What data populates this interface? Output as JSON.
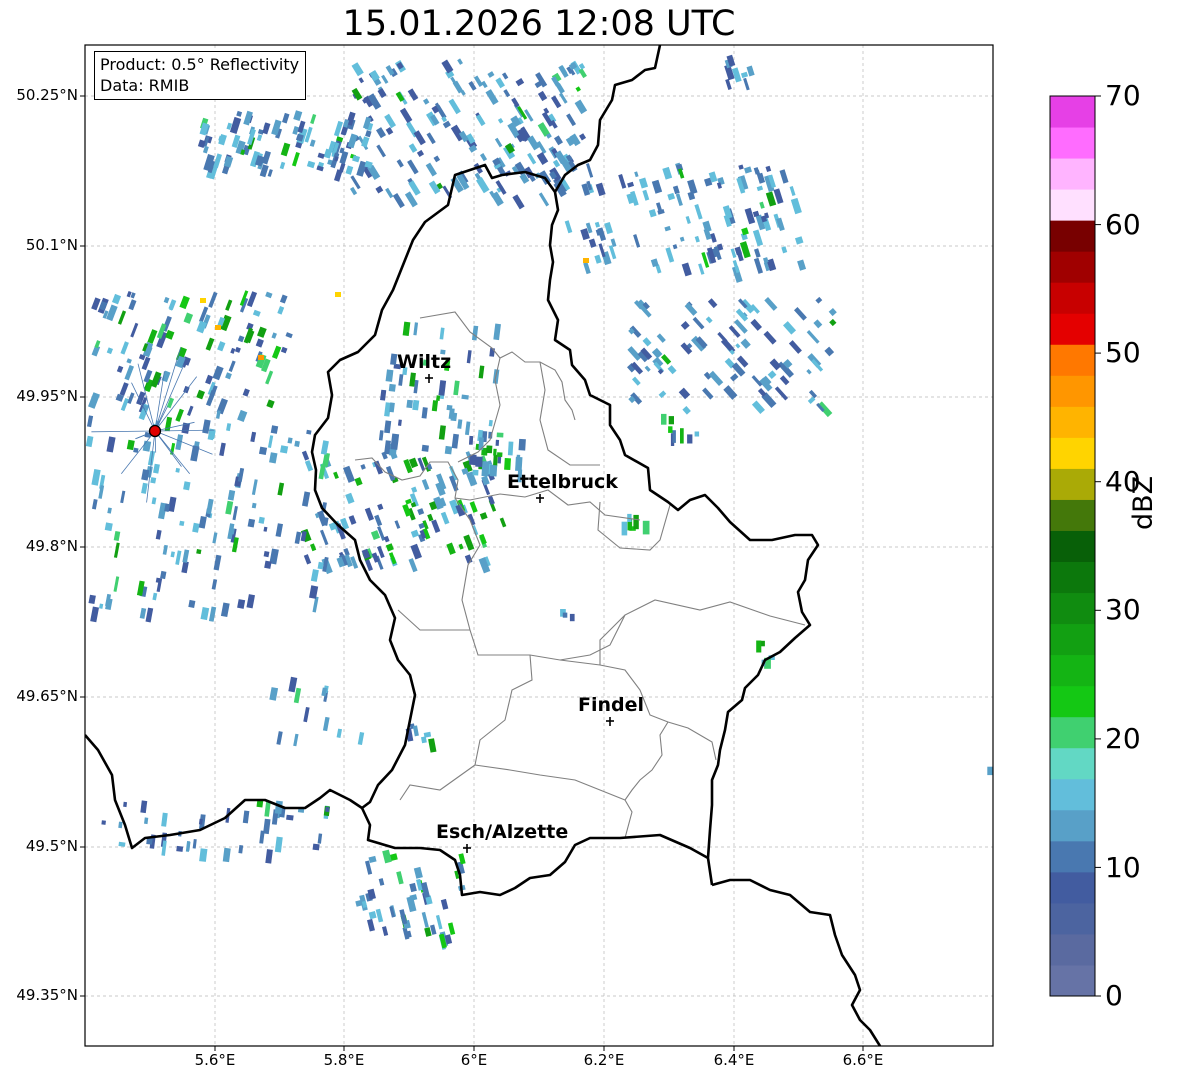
{
  "title": "15.01.2026 12:08 UTC",
  "info_box": {
    "product": "Product: 0.5° Reflectivity",
    "data_source": "Data: RMIB"
  },
  "map": {
    "lon_range": [
      5.4,
      6.8
    ],
    "lat_range": [
      49.3,
      50.3
    ],
    "latitude_ticks": [
      "50.25°N",
      "50.1°N",
      "49.95°N",
      "49.8°N",
      "49.65°N",
      "49.5°N",
      "49.35°N"
    ],
    "longitude_ticks": [
      "5.6°E",
      "5.8°E",
      "6°E",
      "6.2°E",
      "6.4°E",
      "6.6°E"
    ],
    "grid": true,
    "radar_site_color": "#e00000",
    "cities": [
      {
        "name": "Wiltz"
      },
      {
        "name": "Ettelbruck"
      },
      {
        "name": "Findel"
      },
      {
        "name": "Esch/Alzette"
      }
    ]
  },
  "colorbar": {
    "label": "dBZ",
    "ticks": [
      "70",
      "60",
      "50",
      "40",
      "30",
      "20",
      "10",
      "0"
    ],
    "range": [
      0,
      70
    ],
    "step_dbz": 2.5,
    "colors": [
      "#6673a6",
      "#5a6aa0",
      "#4c64a0",
      "#425ca0",
      "#4978b0",
      "#58a0c8",
      "#62bedb",
      "#62d8c4",
      "#40d070",
      "#14c814",
      "#14b414",
      "#12a012",
      "#108c10",
      "#0c780c",
      "#086008",
      "#44780a",
      "#aaaa06",
      "#ffd400",
      "#ffb400",
      "#ff9600",
      "#ff7800",
      "#e40000",
      "#c80000",
      "#a00000",
      "#780000",
      "#ffe0ff",
      "#ffb4ff",
      "#ff6cff",
      "#e640e6"
    ]
  }
}
